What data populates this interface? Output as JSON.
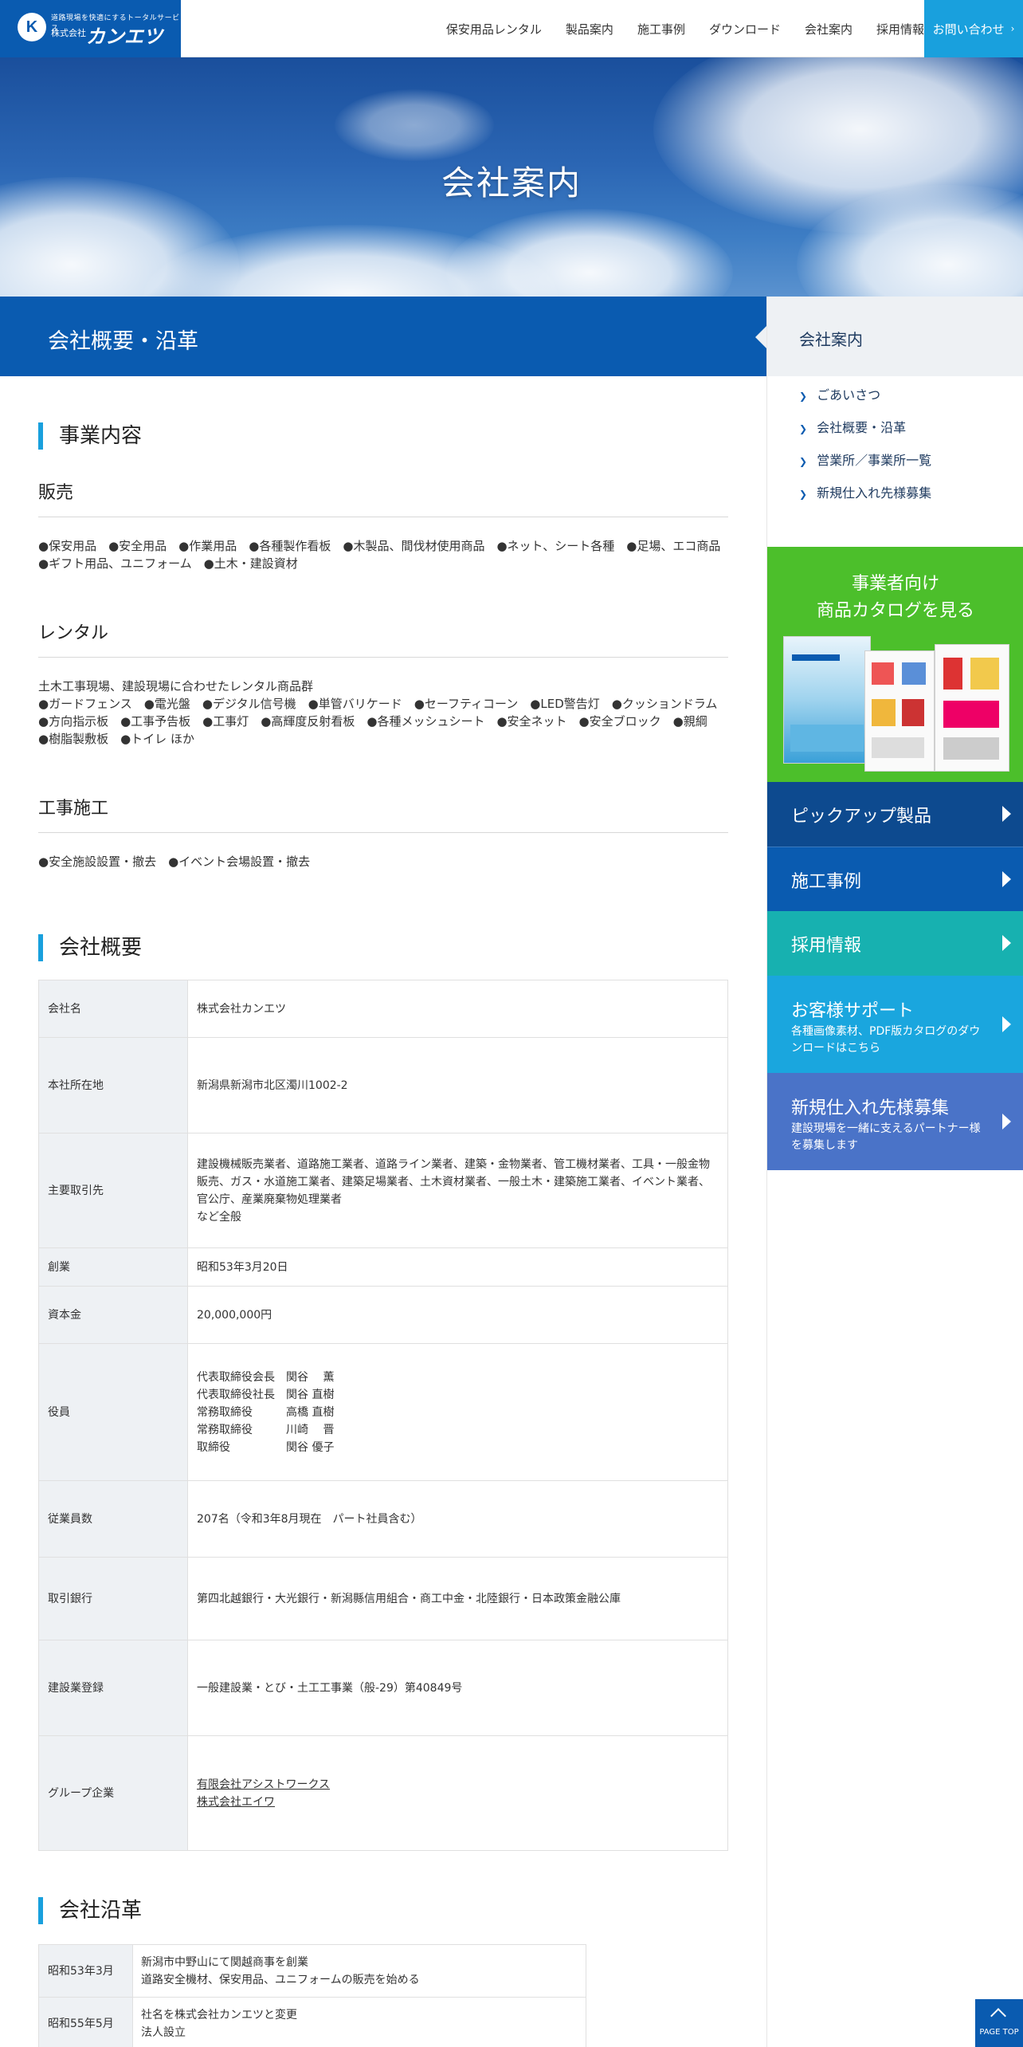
{
  "header": {
    "logo_mark": "K",
    "logo_tagline": "道路現場を快適にするトータルサービス",
    "logo_company_prefix": "株式会社",
    "logo_name": "カンエツ",
    "nav": [
      "保安用品レンタル",
      "製品案内",
      "施工事例",
      "ダウンロード",
      "会社案内",
      "採用情報"
    ],
    "contact_label": "お問い合わせ",
    "contact_arrow": "›"
  },
  "hero": {
    "title": "会社案内"
  },
  "section_bar": {
    "title": "会社概要・沿革"
  },
  "sidebar": {
    "heading": "会社案内",
    "links": [
      "ごあいさつ",
      "会社概要・沿革",
      "営業所／事業所一覧",
      "新規仕入れ先様募集"
    ],
    "catalog_title_line1": "事業者向け",
    "catalog_title_line2": "商品カタログを見る",
    "buttons": [
      {
        "title": "ピックアップ製品",
        "sub": "",
        "color": "#0d4a8f"
      },
      {
        "title": "施工事例",
        "sub": "",
        "color": "#0a5bb0"
      },
      {
        "title": "採用情報",
        "sub": "",
        "color": "#17b1b0"
      },
      {
        "title": "お客様サポート",
        "sub": "各種画像素材、PDF版カタログのダウンロードはこちら",
        "color": "#1aa6de"
      },
      {
        "title": "新規仕入れ先様募集",
        "sub": "建設現場を一緒に支えるパートナー様を募集します",
        "color": "#4a73c8"
      }
    ]
  },
  "business": {
    "heading": "事業内容",
    "sales_heading": "販売",
    "sales_text": "●保安用品　●安全用品　●作業用品　●各種製作看板　●木製品、間伐材使用商品　●ネット、シート各種　●足場、エコ商品　●ギフト用品、ユニフォーム　●土木・建設資材",
    "rental_heading": "レンタル",
    "rental_intro": "土木工事現場、建設現場に合わせたレンタル商品群",
    "rental_text": "●ガードフェンス　●電光盤　●デジタル信号機　●単管バリケード　●セーフティコーン　●LED警告灯　●クッションドラム　●方向指示板　●工事予告板　●工事灯　●高輝度反射看板　●各種メッシュシート　●安全ネット　●安全ブロック　●親綱　●樹脂製敷板　●トイレ ほか",
    "construction_heading": "工事施工",
    "construction_text": "●安全施設設置・撤去　●イベント会場設置・撤去"
  },
  "overview": {
    "heading": "会社概要",
    "rows": [
      {
        "key": "会社名",
        "lines": [
          "株式会社カンエツ"
        ]
      },
      {
        "key": "本社所在地",
        "lines": [
          "新潟県新潟市北区濁川1002-2"
        ]
      },
      {
        "key": "主要取引先",
        "lines": [
          "建設機械販売業者、道路施工業者、道路ライン業者、建築・金物業者、管工機材業者、工具・一般金物販売、ガス・水道施工業者、建築足場業者、土木資材業者、一般土木・建築施工業者、イベント業者、官公庁、産業廃棄物処理業者",
          "など全般"
        ]
      },
      {
        "key": "創業",
        "lines": [
          "昭和53年3月20日"
        ]
      },
      {
        "key": "資本金",
        "lines": [
          "20,000,000円"
        ]
      },
      {
        "key": "役員",
        "lines": [
          "代表取締役会長　関谷　 薫",
          "代表取締役社長　関谷 直樹",
          "常務取締役　　　高橋 直樹",
          "常務取締役　　　川崎　 晋",
          "取締役　　　　　関谷 優子"
        ]
      },
      {
        "key": "従業員数",
        "lines": [
          "207名（令和3年8月現在　パート社員含む）"
        ]
      },
      {
        "key": "取引銀行",
        "lines": [
          "第四北越銀行・大光銀行・新潟縣信用組合・商工中金・北陸銀行・日本政策金融公庫"
        ]
      },
      {
        "key": "建設業登録",
        "lines": [
          "一般建設業・とび・土工工事業（般-29）第40849号"
        ]
      },
      {
        "key": "グループ企業",
        "lines": [
          "有限会社アシストワークス",
          "株式会社エイワ"
        ]
      }
    ]
  },
  "history": {
    "heading": "会社沿革",
    "rows": [
      {
        "key": "昭和53年3月",
        "lines": [
          "新潟市中野山にて関越商事を創業",
          "道路安全機材、保安用品、ユニフォームの販売を始める"
        ]
      },
      {
        "key": "昭和55年5月",
        "lines": [
          "社名を株式会社カンエツと変更",
          "法人設立"
        ]
      }
    ]
  },
  "pagetop": {
    "label": "PAGE TOP"
  },
  "colors": {
    "brand_blue": "#0a5bb0",
    "accent_cyan": "#19a0dd",
    "catalog_green": "#4cbf2b"
  }
}
